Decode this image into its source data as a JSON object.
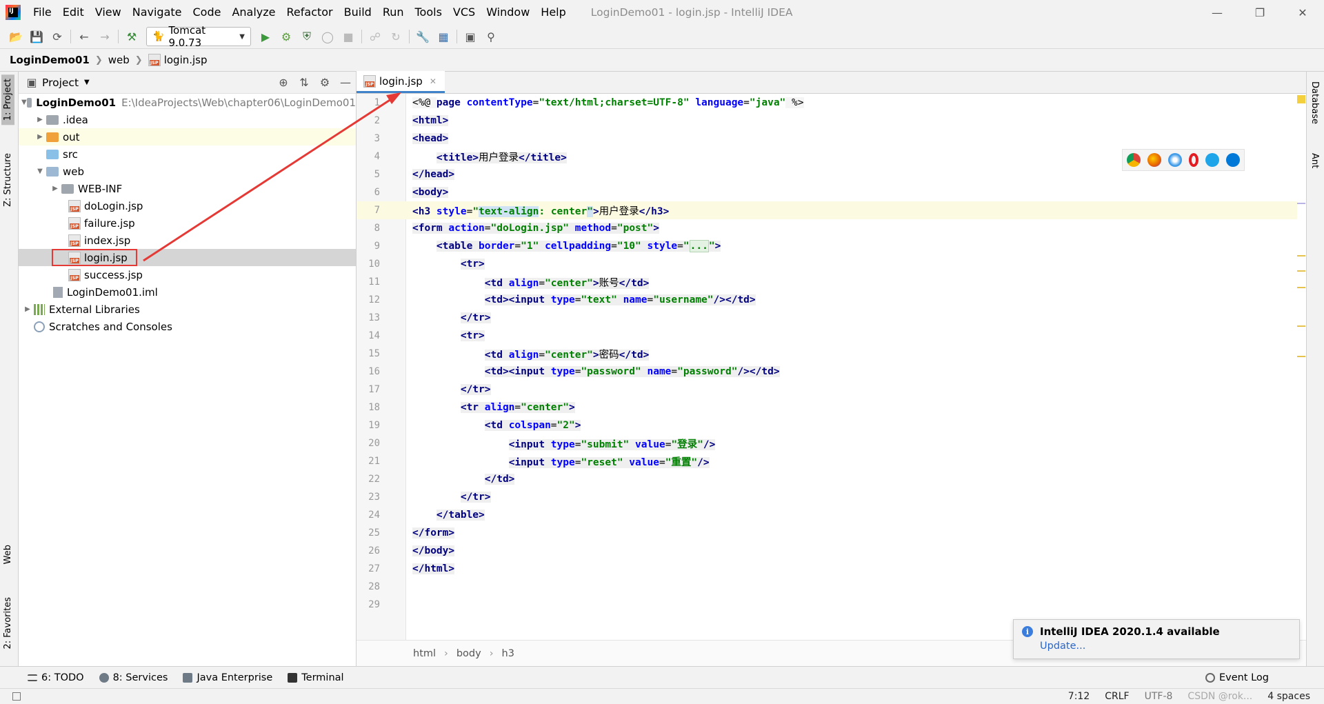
{
  "window": {
    "title": "LoginDemo01 - login.jsp - IntelliJ IDEA",
    "menu": [
      "File",
      "Edit",
      "View",
      "Navigate",
      "Code",
      "Analyze",
      "Refactor",
      "Build",
      "Run",
      "Tools",
      "VCS",
      "Window",
      "Help"
    ]
  },
  "toolbar": {
    "run_config": "Tomcat 9.0.73"
  },
  "navbar": {
    "crumbs": [
      "LoginDemo01",
      "web",
      "login.jsp"
    ]
  },
  "left_stripe": {
    "project_tab": "1: Project",
    "structure_tab": "Z: Structure",
    "web_tab": "Web",
    "favorites_tab": "2: Favorites"
  },
  "right_stripe": {
    "database_tab": "Database",
    "ant_tab": "Ant"
  },
  "project_panel": {
    "title": "Project",
    "root": "LoginDemo01",
    "root_path": "E:\\IdeaProjects\\Web\\chapter06\\LoginDemo01",
    "items": {
      "idea": ".idea",
      "out": "out",
      "src": "src",
      "web": "web",
      "webinf": "WEB-INF",
      "dologin": "doLogin.jsp",
      "failure": "failure.jsp",
      "index": "index.jsp",
      "login": "login.jsp",
      "success": "success.jsp",
      "iml": "LoginDemo01.iml",
      "external": "External Libraries",
      "scratches": "Scratches and Consoles"
    }
  },
  "editor": {
    "tab": "login.jsp",
    "line_numbers": [
      "1",
      "2",
      "3",
      "4",
      "5",
      "6",
      "7",
      "8",
      "9",
      "10",
      "11",
      "12",
      "13",
      "14",
      "15",
      "16",
      "17",
      "18",
      "19",
      "20",
      "21",
      "22",
      "23",
      "24",
      "25",
      "26",
      "27",
      "28",
      "29"
    ],
    "breadcrumb": [
      "html",
      "body",
      "h3"
    ],
    "lines": {
      "l1": "<%@ page contentType=\"text/html;charset=UTF-8\" language=\"java\" %>",
      "l4_text": "用户登录",
      "l7_text": "用户登录",
      "l11_text": "账号",
      "l15_text": "密码",
      "l20_value": "登录",
      "l21_value": "重置"
    }
  },
  "notification": {
    "title": "IntelliJ IDEA 2020.1.4 available",
    "link": "Update..."
  },
  "bottom_tools": {
    "todo": "6: TODO",
    "services": "8: Services",
    "java_ee": "Java Enterprise",
    "terminal": "Terminal",
    "event_log": "Event Log"
  },
  "status": {
    "position": "7:12",
    "line_sep": "CRLF",
    "encoding": "UTF-8",
    "indent": "4 spaces",
    "watermark": "CSDN @rok..."
  },
  "colors": {
    "selection_box": "#e53935",
    "annotation_arrow": "#e53935",
    "tab_underline": "#4083c9"
  }
}
